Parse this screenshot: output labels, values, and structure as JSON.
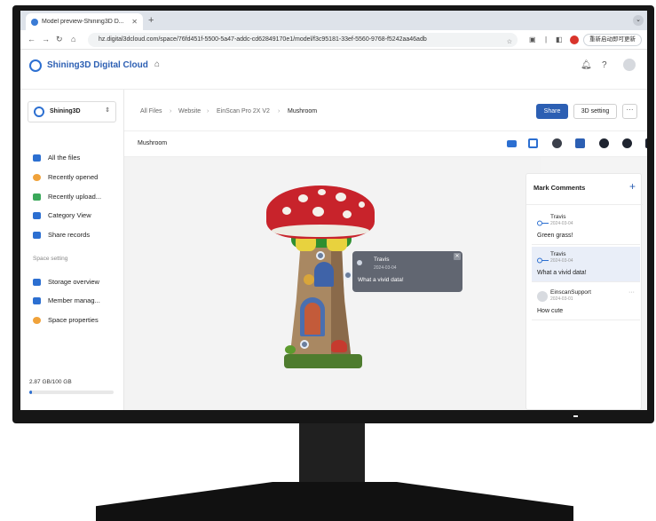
{
  "browser": {
    "tab_title": "Model preview-Shining3D D...",
    "tab_close": "✕",
    "new_tab": "+",
    "url": "hz.digital3dcloud.com/space/76fd451f-5500-5a47-addc-cd62849170e1/model/f3c95181-33ef-5560-9768-f5242aa46adb",
    "update_label": "重新启动即可更新"
  },
  "app": {
    "brand": "Shining3D Digital Cloud"
  },
  "sidebar": {
    "space_name": "Shining3D",
    "items": [
      {
        "label": "All the files",
        "color": "#2c6fd1"
      },
      {
        "label": "Recently opened",
        "color": "#f0a23a"
      },
      {
        "label": "Recently upload...",
        "color": "#3aa85a"
      },
      {
        "label": "Category View",
        "color": "#2c6fd1"
      },
      {
        "label": "Share records",
        "color": "#2c6fd1"
      }
    ],
    "section_label": "Space setting",
    "settings": [
      {
        "label": "Storage overview",
        "color": "#2c6fd1"
      },
      {
        "label": "Member manag...",
        "color": "#2c6fd1"
      },
      {
        "label": "Space properties",
        "color": "#f0a23a"
      }
    ],
    "storage_text": "2.87 GB/100 GB",
    "storage_fraction": 0.0287
  },
  "breadcrumb": [
    "All Files",
    "Website",
    "EinScan Pro 2X V2",
    "Mushroom"
  ],
  "actions": {
    "share": "Share",
    "settings_3d": "3D setting",
    "more": "···"
  },
  "model": {
    "title": "Mushroom"
  },
  "tooltip": {
    "name": "Travis",
    "date": "2024-03-04",
    "text": "What a vivid data!",
    "close": "✕"
  },
  "comments": {
    "title": "Mark Comments",
    "add": "+",
    "items": [
      {
        "name": "Travis",
        "date": "2024-03-04",
        "text": "Green grass!",
        "active": false
      },
      {
        "name": "Travis",
        "date": "2024-03-04",
        "text": "What a vivid data!",
        "active": true
      },
      {
        "name": "EinscanSupport",
        "date": "2024-03-01",
        "text": "How cute",
        "active": false,
        "more": "···"
      }
    ]
  },
  "colors": {
    "brand": "#2c5fb3",
    "accent": "#2c6fd1",
    "active_comment": "#e9eef8"
  }
}
